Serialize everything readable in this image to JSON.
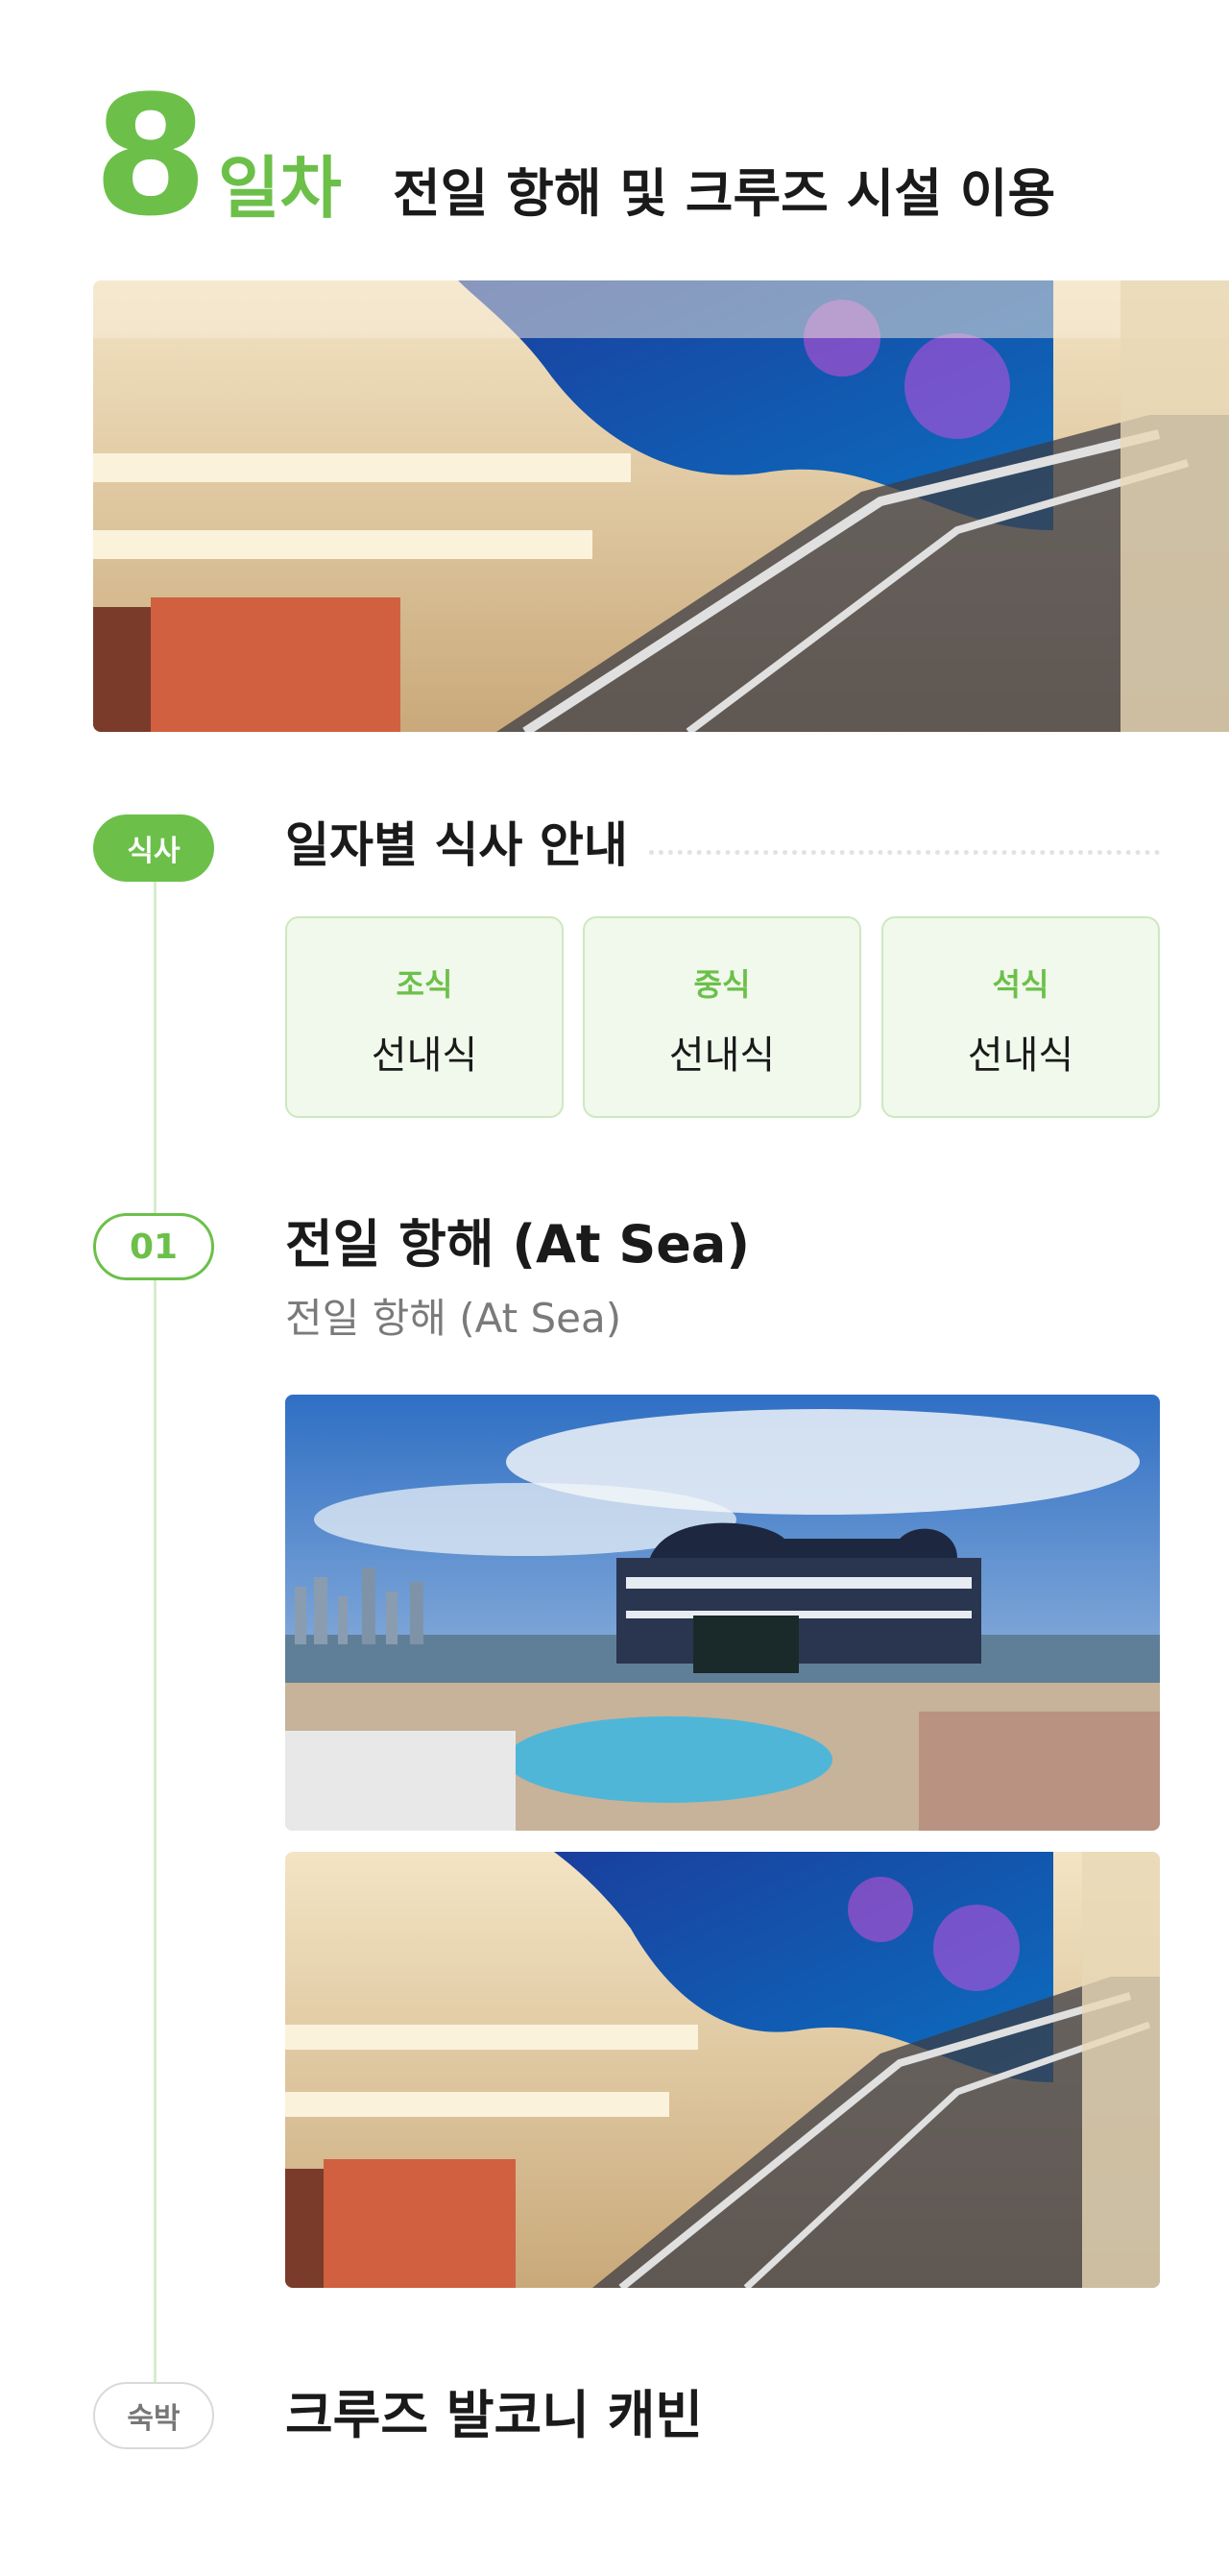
{
  "day": {
    "number": "8",
    "unit": "일차",
    "title": "전일 항해 및 크루즈 시설 이용"
  },
  "photos": {
    "top_icon": "cruise-atrium-photo",
    "pool_icon": "cruise-pool-deck-photo",
    "atrium_icon": "cruise-atrium-photo"
  },
  "meals": {
    "badge": "식사",
    "title": "일자별 식사 안내",
    "items": [
      {
        "label": "조식",
        "value": "선내식"
      },
      {
        "label": "중식",
        "value": "선내식"
      },
      {
        "label": "석식",
        "value": "선내식"
      }
    ]
  },
  "itinerary": [
    {
      "badge": "01",
      "title": "전일 항해 (At Sea)",
      "subtitle": "전일 항해 (At Sea)"
    }
  ],
  "stay": {
    "badge": "숙박",
    "title": "크루즈 발코니 캐빈"
  },
  "colors": {
    "accent": "#6cc04a",
    "card_bg": "#f1f8ec",
    "card_border": "#cde8bf",
    "timeline": "#d6eccb"
  }
}
